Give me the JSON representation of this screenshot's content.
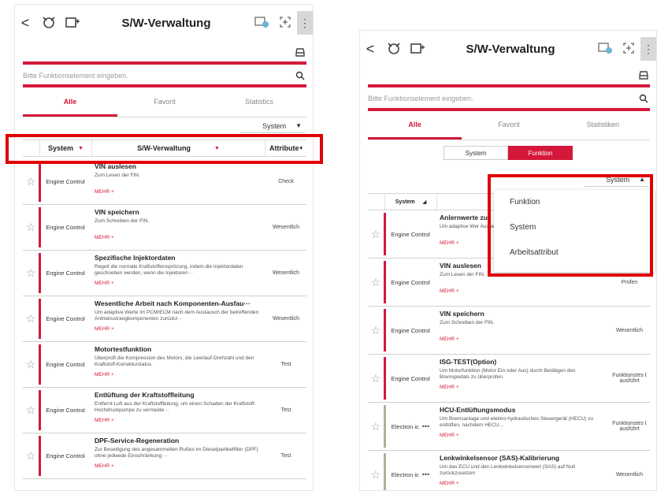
{
  "left": {
    "title": "S/W-Verwaltung",
    "back": "<",
    "more": "⋮",
    "search_placeholder": "Bitte Funktionselement eingeben.",
    "tabs": [
      "Alle",
      "Favorit",
      "Statistics"
    ],
    "dropdown": "System",
    "headers": {
      "system": "System",
      "sw": "S/W-Verwaltung",
      "attr": "Attribute"
    },
    "rows": [
      {
        "system": "Engine Control",
        "title": "VIN auslesen",
        "desc": "Zum Lesen der FIN.",
        "more": "MEHR +",
        "attr": "Check"
      },
      {
        "system": "Engine Control",
        "title": "VIN speichern",
        "desc": "Zum Schreiben der FIN.",
        "more": "MEHR +",
        "attr": "Wesentlich"
      },
      {
        "system": "Engine Control",
        "title": "Spezifische Injektordaten",
        "desc": "Regelt die normale Kraftstoffeinspritzung, indem die Injektordaten geschrieben werden, wenn die Injektoren···",
        "more": "MEHR +",
        "attr": "Wesentlich"
      },
      {
        "system": "Engine Control",
        "title": "Wesentliche Arbeit nach Komponenten-Ausfau···",
        "desc": "Um adaptive Werte im PCM/ECM nach dem Austausch der betreffenden Antriebsstrangkomponenten zurückz···",
        "more": "MEHR +",
        "attr": "Wesentlich"
      },
      {
        "system": "Engine Control",
        "title": "Motortestfunktion",
        "desc": "Überprüft die Kompression des Motors, die Leerlauf-Drehzahl und den Kraftstoff-Korrekturstatus.",
        "more": "MEHR +",
        "attr": "Test"
      },
      {
        "system": "Engine Control",
        "title": "Entlüftung der Kraftstoffleitung",
        "desc": "Entfernt Luft aus der Kraftstoffleitung, um einen Schaden der Kraftstoff-Hochdruckpumpe zu vermeide···",
        "more": "MEHR +",
        "attr": "Test"
      },
      {
        "system": "Engine Control",
        "title": "DPF-Service-Regeneration",
        "desc": "Zur Beseitigung des angesammelten Rußes im Dieselpartikelfilter (DPF) ohne jedwede Einschränkung ···",
        "more": "MEHR +",
        "attr": "Test"
      }
    ]
  },
  "right": {
    "title": "S/W-Verwaltung",
    "back": "<",
    "more": "⋮",
    "search_placeholder": "Bitte Funktionselement eingeben.",
    "tabs": [
      "Alle",
      "Favorit",
      "Statistiken"
    ],
    "segment": [
      "System",
      "Funktion"
    ],
    "dropdown": "System",
    "header_system": "System",
    "popup_options": [
      "Funktion",
      "System",
      "Arbeitsattribut"
    ],
    "rows": [
      {
        "system": "Engine Control",
        "title": "Anlernwerte zu",
        "desc": "Um adaptive Wer Austausch des b",
        "more": "MEHR +",
        "attr": ""
      },
      {
        "system": "Engine Control",
        "title": "VIN auslesen",
        "desc": "Zum Lesen der FIN.",
        "more": "MEHR +",
        "attr": "Prüfen"
      },
      {
        "system": "Engine Control",
        "title": "VIN speichern",
        "desc": "Zum Schreiben der FIN.",
        "more": "MEHR +",
        "attr": "Wesentlich"
      },
      {
        "system": "Engine Control",
        "title": "ISG-TEST(Option)",
        "desc": "Um Motorfunktion (Motor Ein oder Aus) durch Betätigen des Bremspedals zu überprüfen.",
        "more": "MEHR +",
        "attr": "Funktionstes t ausführt"
      },
      {
        "system": "Electron ic",
        "title": "HCU-Entlüftungsmodus",
        "desc": "Um Bremsanlage und elektro-hydraulisches Steuergerät (HECU) zu entlüften, nachdem HECU...",
        "more": "MEHR +",
        "attr": "Funktionstes t ausführt"
      },
      {
        "system": "Electron ic",
        "title": "Lenkwinkelsensor (SAS)-Kalibrierung",
        "desc": "Um das ECU und den Lenkwinkelsensorwert (SAS) auf Null zurückzusetzen",
        "more": "MEHR +",
        "attr": "Wesentlich"
      }
    ]
  },
  "colors": {
    "accent": "#d4183a",
    "highlight": "#e00000"
  }
}
